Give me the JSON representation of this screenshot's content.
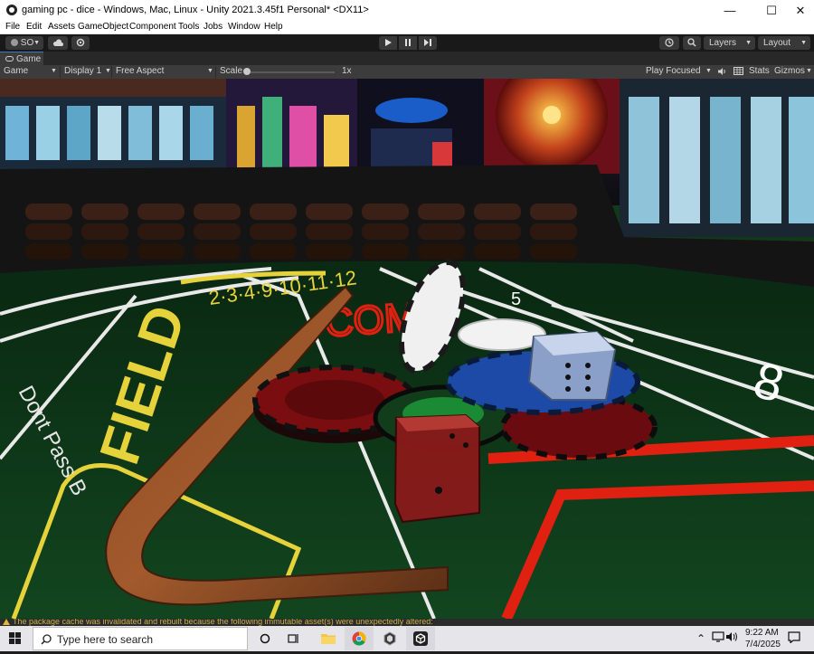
{
  "window": {
    "title": "gaming pc - dice - Windows, Mac, Linux - Unity 2021.3.45f1 Personal* <DX11>",
    "controls": {
      "minimize": "—",
      "maximize": "☐",
      "close": "✕"
    }
  },
  "menu": [
    "File",
    "Edit",
    "Assets",
    "GameObject",
    "Component",
    "Tools",
    "Jobs",
    "Window",
    "Help"
  ],
  "toolbar": {
    "account_label": "SO",
    "layers_label": "Layers",
    "layout_label": "Layout",
    "icons": [
      "cloud-icon",
      "settings-icon",
      "play-icon",
      "pause-icon",
      "step-icon",
      "history-icon",
      "search-icon"
    ]
  },
  "tab": {
    "label": "Game"
  },
  "game_bar": {
    "mode": "Game",
    "display": "Display 1",
    "aspect": "Free Aspect",
    "scale_label": "Scale",
    "scale_value": "1x",
    "scale_level": 0,
    "play_focused": "Play Focused",
    "stats": "Stats",
    "gizmos": "Gizmos"
  },
  "scene": {
    "table_text": {
      "dont_pass": "Dont Pass B",
      "field": "FIELD",
      "field_numbers": "2·3·4·9·10·11·12",
      "come": "COME",
      "number_eight": "8",
      "number_five": "5"
    },
    "colors": {
      "felt": "#0f3d1b",
      "rail": "#3a2016",
      "red_chip": "#7a0d10",
      "blue_chip": "#1d4aa6"
    }
  },
  "console": {
    "message": "The package cache was invalidated and rebuilt because the following immutable asset(s) were unexpectedly altered:"
  },
  "taskbar": {
    "search_placeholder": "Type here to search",
    "apps": [
      "task-view-icon",
      "file-explorer-icon",
      "chrome-icon",
      "unity-hub-icon",
      "unity-icon"
    ],
    "time": "9:22 AM",
    "date": "7/4/2025"
  }
}
